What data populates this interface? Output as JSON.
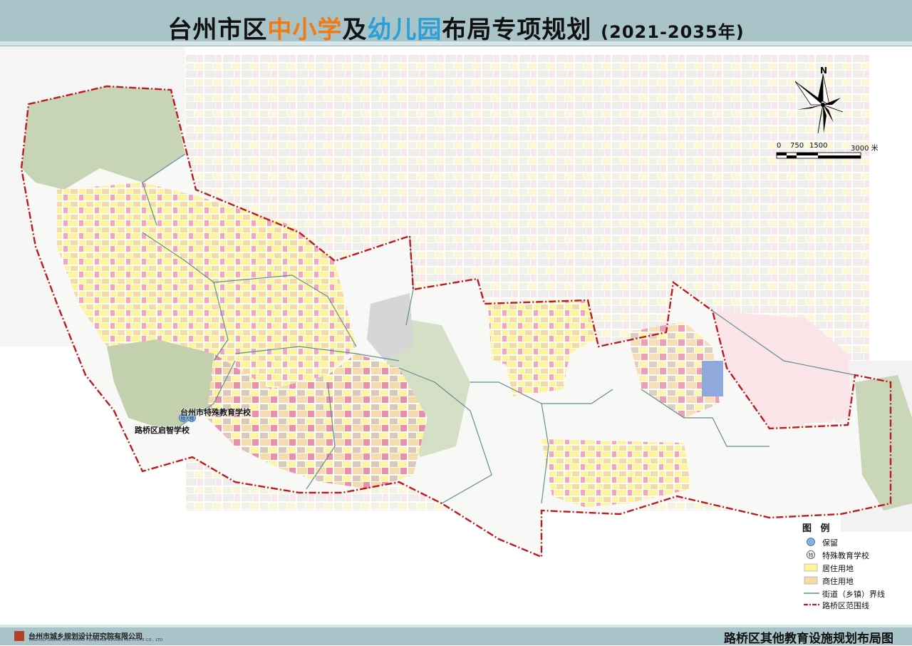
{
  "header": {
    "title_part1": "台州市区",
    "title_part2": "中小学",
    "title_part3": "及",
    "title_part4": "幼儿园",
    "title_part5": "布局",
    "title_part6": "专项规划",
    "title_year": "(2021-2035年)"
  },
  "map": {
    "north_label": "N",
    "scale": {
      "labels": [
        "0",
        "750",
        "1500",
        "3000 米"
      ]
    },
    "schools": [
      {
        "name": "台州市特殊教育学校",
        "symbol": "特"
      },
      {
        "name": "路桥区启智学校",
        "symbol": "特"
      }
    ]
  },
  "legend": {
    "title": "图 例",
    "items": [
      {
        "label": "保留",
        "symbol": "circle"
      },
      {
        "label": "特殊教育学校",
        "symbol": "特"
      },
      {
        "label": "居住用地",
        "symbol": "swatch"
      },
      {
        "label": "商住用地",
        "symbol": "swatch"
      },
      {
        "label": "街道（乡镇）界线",
        "symbol": "line"
      },
      {
        "label": "路桥区范围线",
        "symbol": "dashline"
      }
    ]
  },
  "colors": {
    "header_bg": "#a9c4c9",
    "orange": "#f07a14",
    "blue": "#2c9fd6",
    "residential": "#fdf59a",
    "commercial_residential": "#f6d9a8",
    "retain_circle": "#7fb2e0",
    "street_boundary": "#5f8e93",
    "district_boundary": "#b81c22"
  },
  "footer": {
    "org_name": "台州市城乡规划设计研究院有限公司",
    "org_en": "TAIZHOU URBAN AND RURAL PLANNING DESIGN INSTITUTE CO., LTD.",
    "map_title": "路桥区其他教育设施规划布局图"
  }
}
